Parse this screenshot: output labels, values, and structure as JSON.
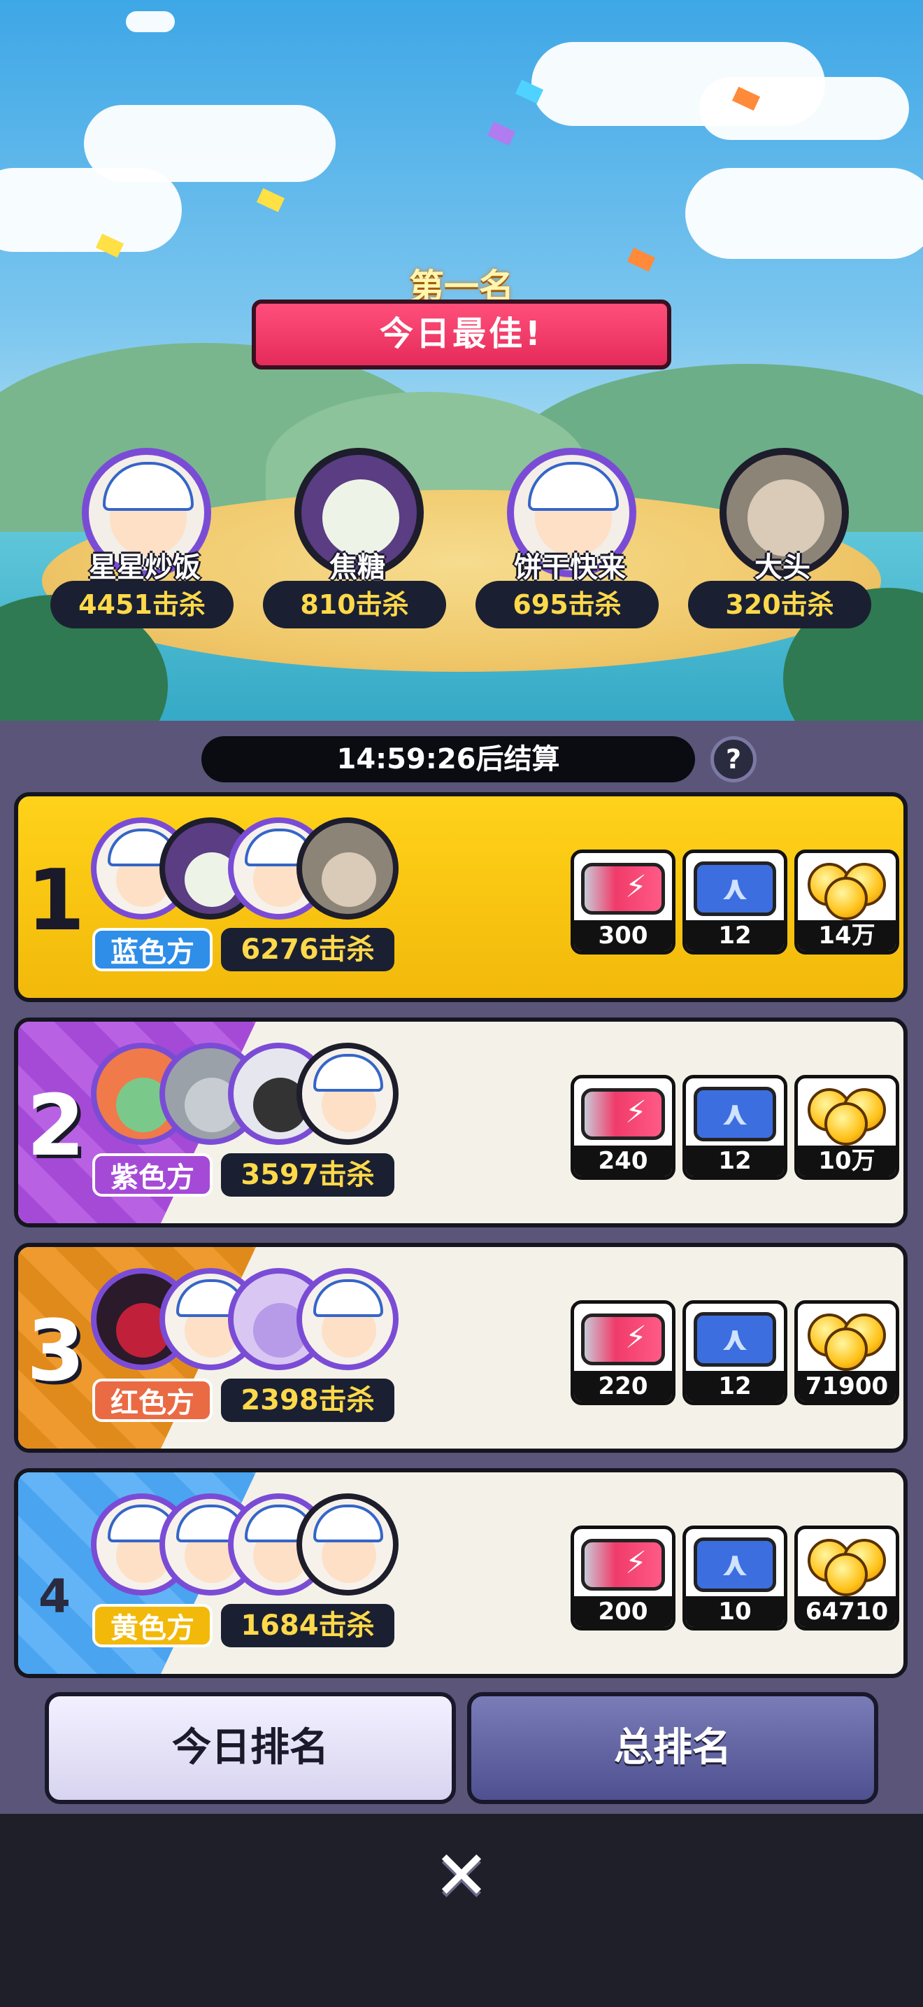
{
  "hero": {
    "rank_title": "第一名",
    "subtitle": "今日最佳!",
    "players": [
      {
        "name": "星星炒饭",
        "kills": "4451击杀",
        "avatar": "boy-cap-avatar"
      },
      {
        "name": "焦糖",
        "kills": "810击杀",
        "avatar": "panda-avatar"
      },
      {
        "name": "饼干快来",
        "kills": "695击杀",
        "avatar": "boy-cap-avatar"
      },
      {
        "name": "大头",
        "kills": "320击杀",
        "avatar": "photo-avatar"
      }
    ]
  },
  "settlement": {
    "timer": "14:59:26后结算",
    "help_label": "?"
  },
  "teams": [
    {
      "rank": "1",
      "team": "蓝色方",
      "kills": "6276击杀",
      "team_color": "#2f8ee8",
      "rewards": [
        {
          "icon": "energy-can-icon",
          "qty": "300"
        },
        {
          "icon": "ticket-icon",
          "qty": "12"
        },
        {
          "icon": "gold-coins-icon",
          "qty": "14万"
        }
      ]
    },
    {
      "rank": "2",
      "team": "紫色方",
      "kills": "3597击杀",
      "team_color": "#a54ad6",
      "rewards": [
        {
          "icon": "energy-can-icon",
          "qty": "240"
        },
        {
          "icon": "ticket-icon",
          "qty": "12"
        },
        {
          "icon": "gold-coins-icon",
          "qty": "10万"
        }
      ]
    },
    {
      "rank": "3",
      "team": "红色方",
      "kills": "2398击杀",
      "team_color": "#ea6a44",
      "rewards": [
        {
          "icon": "energy-can-icon",
          "qty": "220"
        },
        {
          "icon": "ticket-icon",
          "qty": "12"
        },
        {
          "icon": "gold-coins-icon",
          "qty": "71900"
        }
      ]
    },
    {
      "rank": "4",
      "team": "黄色方",
      "kills": "1684击杀",
      "team_color": "#f2b90a",
      "rewards": [
        {
          "icon": "energy-can-icon",
          "qty": "200"
        },
        {
          "icon": "ticket-icon",
          "qty": "10"
        },
        {
          "icon": "gold-coins-icon",
          "qty": "64710"
        }
      ]
    }
  ],
  "tabs": {
    "today": "今日排名",
    "total": "总排名"
  },
  "close_icon": "close-icon"
}
